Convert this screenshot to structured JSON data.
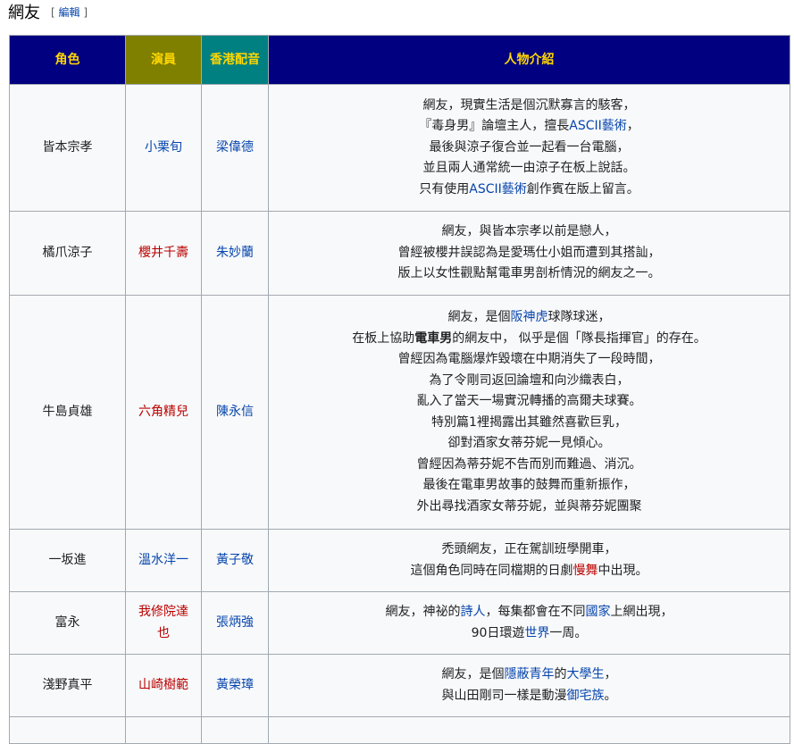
{
  "section": {
    "title": "網友",
    "edit_open": "[",
    "edit_label": "編輯",
    "edit_close": "]"
  },
  "header_colors": {
    "role": "#000080",
    "actor": "#808000",
    "hk": "#008080",
    "intro": "#000080",
    "text": "#ffd700"
  },
  "columns": {
    "role": "角色",
    "actor": "演員",
    "hk_voice": "香港配音",
    "intro": "人物介紹"
  },
  "rows": [
    {
      "role": "皆本宗孝",
      "actor": {
        "text": "小栗旬",
        "kind": "link"
      },
      "hk_voice": {
        "text": "梁偉德",
        "kind": "link"
      },
      "lines": [
        [
          {
            "t": "網友，現實生活是個沉默寡言的駭客，"
          }
        ],
        [
          {
            "t": "『毒身男』論壇主人，擅長"
          },
          {
            "t": "ASCII藝術",
            "k": "link"
          },
          {
            "t": "，"
          }
        ],
        [
          {
            "t": "最後與涼子復合並一起看一台電腦，"
          }
        ],
        [
          {
            "t": "並且兩人通常統一由涼子在板上說話。"
          }
        ],
        [
          {
            "t": "只有使用"
          },
          {
            "t": "ASCII藝術",
            "k": "link"
          },
          {
            "t": "創作賓在版上留言。"
          }
        ]
      ]
    },
    {
      "role": "橘爪涼子",
      "actor": {
        "text": "櫻井千壽",
        "kind": "red"
      },
      "hk_voice": {
        "text": "朱妙蘭",
        "kind": "link"
      },
      "lines": [
        [
          {
            "t": "網友，與皆本宗孝以前是戀人，"
          }
        ],
        [
          {
            "t": "曾經被櫻井誤認為是愛瑪仕小姐而遭到其搭訕，"
          }
        ],
        [
          {
            "t": "版上以女性觀點幫電車男剖析情況的網友之一。"
          }
        ]
      ]
    },
    {
      "role": "牛島貞雄",
      "actor": {
        "text": "六角精兒",
        "kind": "red"
      },
      "hk_voice": {
        "text": "陳永信",
        "kind": "link"
      },
      "lines": [
        [
          {
            "t": "網友，是個"
          },
          {
            "t": "阪神虎",
            "k": "link"
          },
          {
            "t": "球隊球迷，"
          }
        ],
        [
          {
            "t": "在板上協助"
          },
          {
            "t": "電車男",
            "k": "bold"
          },
          {
            "t": "的網友中， 似乎是個「隊長指揮官」的存在。"
          }
        ],
        [
          {
            "t": "曾經因為電腦爆炸毀壞在中期消失了一段時間，"
          }
        ],
        [
          {
            "t": "為了令剛司返回論壇和向沙織表白，"
          }
        ],
        [
          {
            "t": "亂入了當天一場實況轉播的高爾夫球賽。"
          }
        ],
        [
          {
            "t": "特別篇1裡揭露出其雖然喜歡巨乳，"
          }
        ],
        [
          {
            "t": "卻對酒家女蒂芬妮一見傾心。"
          }
        ],
        [
          {
            "t": "曾經因為蒂芬妮不告而別而難過、消沉。"
          }
        ],
        [
          {
            "t": "最後在電車男故事的鼓舞而重新振作，"
          }
        ],
        [
          {
            "t": "外出尋找酒家女蒂芬妮，並與蒂芬妮團聚"
          }
        ]
      ]
    },
    {
      "role": "一坂進",
      "actor": {
        "text": "溫水洋一",
        "kind": "link"
      },
      "hk_voice": {
        "text": "黃子敬",
        "kind": "link"
      },
      "lines": [
        [
          {
            "t": "禿頭網友，正在駕訓班學開車，"
          }
        ],
        [
          {
            "t": "這個角色同時在同檔期的日劇"
          },
          {
            "t": "慢舞",
            "k": "red"
          },
          {
            "t": "中出現。"
          }
        ]
      ]
    },
    {
      "role": "富永",
      "actor": {
        "text": "我修院達也",
        "kind": "red"
      },
      "hk_voice": {
        "text": "張炳強",
        "kind": "link"
      },
      "lines": [
        [
          {
            "t": "網友，神祕的"
          },
          {
            "t": "詩人",
            "k": "link"
          },
          {
            "t": "，每集都會在不同"
          },
          {
            "t": "國家",
            "k": "link"
          },
          {
            "t": "上網出現，"
          }
        ],
        [
          {
            "t": "90日環遊"
          },
          {
            "t": "世界",
            "k": "link"
          },
          {
            "t": "一周。"
          }
        ]
      ]
    },
    {
      "role": "淺野真平",
      "actor": {
        "text": "山崎樹範",
        "kind": "red"
      },
      "hk_voice": {
        "text": "黃榮璋",
        "kind": "link"
      },
      "lines": [
        [
          {
            "t": "網友，是個"
          },
          {
            "t": "隱蔽青年",
            "k": "link"
          },
          {
            "t": "的"
          },
          {
            "t": "大學生",
            "k": "link"
          },
          {
            "t": "，"
          }
        ],
        [
          {
            "t": "與山田剛司一樣是動漫"
          },
          {
            "t": "御宅族",
            "k": "link"
          },
          {
            "t": "。"
          }
        ]
      ]
    },
    {
      "role": "",
      "actor": {
        "text": "",
        "kind": "plain"
      },
      "hk_voice": {
        "text": "",
        "kind": "plain"
      },
      "lines": []
    }
  ]
}
